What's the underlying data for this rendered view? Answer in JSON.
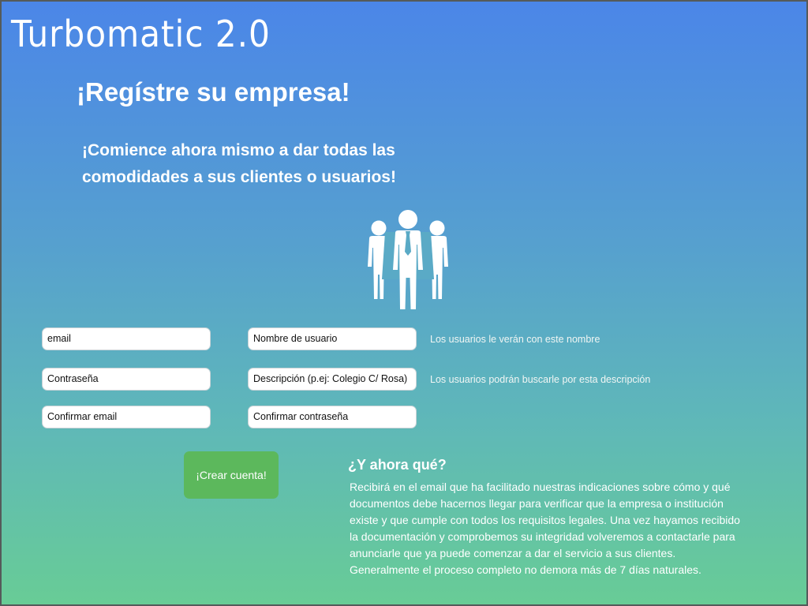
{
  "header": {
    "app_title": "Turbomatic 2.0",
    "headline": "¡Regístre su empresa!",
    "subheadline": "¡Comience ahora mismo a dar todas las comodidades a sus clientes o usuarios!"
  },
  "form": {
    "email": "email",
    "username": "Nombre de usuario",
    "username_hint": "Los usuarios le verán con este nombre",
    "password": "Contraseña",
    "description": "Descripción (p.ej:  Colegio C/ Rosa)",
    "description_hint": "Los usuarios podrán buscarle por esta descripción",
    "confirm_email": "Confirmar email",
    "confirm_password": "Confirmar contraseña",
    "submit_label": "¡Crear cuenta!"
  },
  "info": {
    "title": "¿Y ahora qué?",
    "body": "Recibirá en el email que ha facilitado nuestras indicaciones sobre cómo y qué documentos debe hacernos llegar para verificar que la empresa o institución existe y que cumple con todos los requisitos legales. Una vez hayamos recibido la documentación y comprobemos su integridad volveremos a contactarle para anunciarle que ya puede comenzar a dar el servicio a sus clientes. Generalmente el proceso completo no demora más de 7 días naturales."
  },
  "icons": {
    "hero": "people-group-icon"
  },
  "colors": {
    "gradient_top": "#4b86e8",
    "gradient_bottom": "#68cc96",
    "button": "#5cb85c",
    "text": "#ffffff"
  }
}
